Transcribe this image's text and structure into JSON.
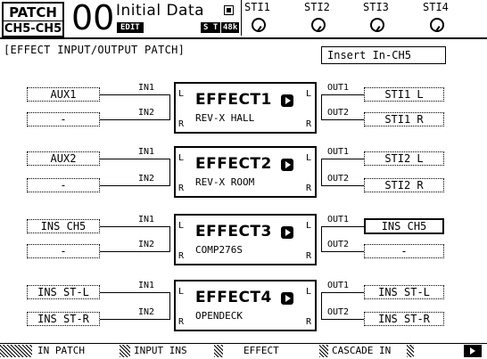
{
  "header": {
    "screen_name": "PATCH",
    "screen_sub": "CH5-CH5",
    "scene_number": "00",
    "scene_title": "Initial Data",
    "edit_badge": "EDIT",
    "protect_icon": "lock-icon",
    "st_badge": "S T",
    "sample_rate": "48k",
    "meters": [
      "STI1",
      "STI2",
      "STI3",
      "STI4"
    ]
  },
  "page": {
    "title": "EFFECT INPUT/OUTPUT PATCH",
    "insert_selector": "Insert In-CH5"
  },
  "effects": [
    {
      "name": "EFFECT1",
      "type": "REV-X HALL",
      "in1": "AUX1",
      "in2": "-",
      "out1": "STI1 L",
      "out2": "STI1 R"
    },
    {
      "name": "EFFECT2",
      "type": "REV-X ROOM",
      "in1": "AUX2",
      "in2": "-",
      "out1": "STI2 L",
      "out2": "STI2 R"
    },
    {
      "name": "EFFECT3",
      "type": "COMP276S",
      "in1": "INS CH5",
      "in2": "-",
      "out1": "INS CH5",
      "out2": "-"
    },
    {
      "name": "EFFECT4",
      "type": "OPENDECK",
      "in1": "INS ST-L",
      "in2": "INS ST-R",
      "out1": "INS ST-L",
      "out2": "INS ST-R"
    }
  ],
  "port_labels": {
    "in1": "IN1",
    "in2": "IN2",
    "out1": "OUT1",
    "out2": "OUT2",
    "l": "L",
    "r": "R"
  },
  "tabs": [
    "IN PATCH",
    "INPUT INS",
    "EFFECT",
    "CASCADE IN"
  ]
}
